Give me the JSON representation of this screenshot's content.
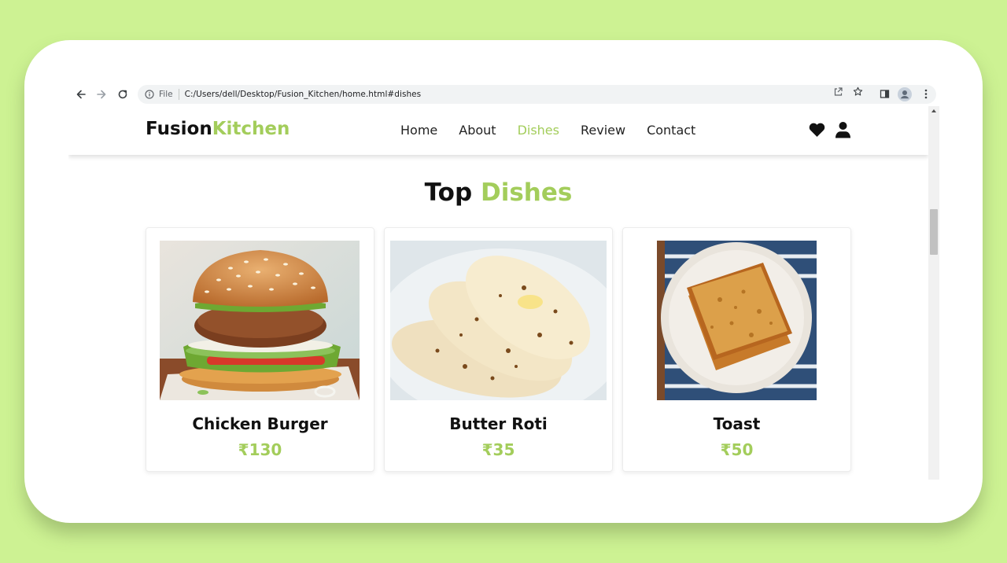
{
  "browser": {
    "file_label": "File",
    "url": "C:/Users/dell/Desktop/Fusion_Kitchen/home.html#dishes"
  },
  "brand": {
    "part1": "Fusion",
    "part2": "Kitchen",
    "accent_color": "#a3cd5b"
  },
  "nav": {
    "items": [
      {
        "label": "Home"
      },
      {
        "label": "About"
      },
      {
        "label": "Dishes",
        "active": true
      },
      {
        "label": "Review"
      },
      {
        "label": "Contact"
      }
    ],
    "icons": [
      "heart-icon",
      "user-icon"
    ]
  },
  "section": {
    "title_part1": "Top",
    "title_part2": "Dishes"
  },
  "dishes": [
    {
      "name": "Chicken Burger",
      "price": "₹130"
    },
    {
      "name": "Butter Roti",
      "price": "₹35"
    },
    {
      "name": "Toast",
      "price": "₹50"
    }
  ],
  "colors": {
    "background": "#cdf293",
    "accent": "#a3cd5b"
  }
}
